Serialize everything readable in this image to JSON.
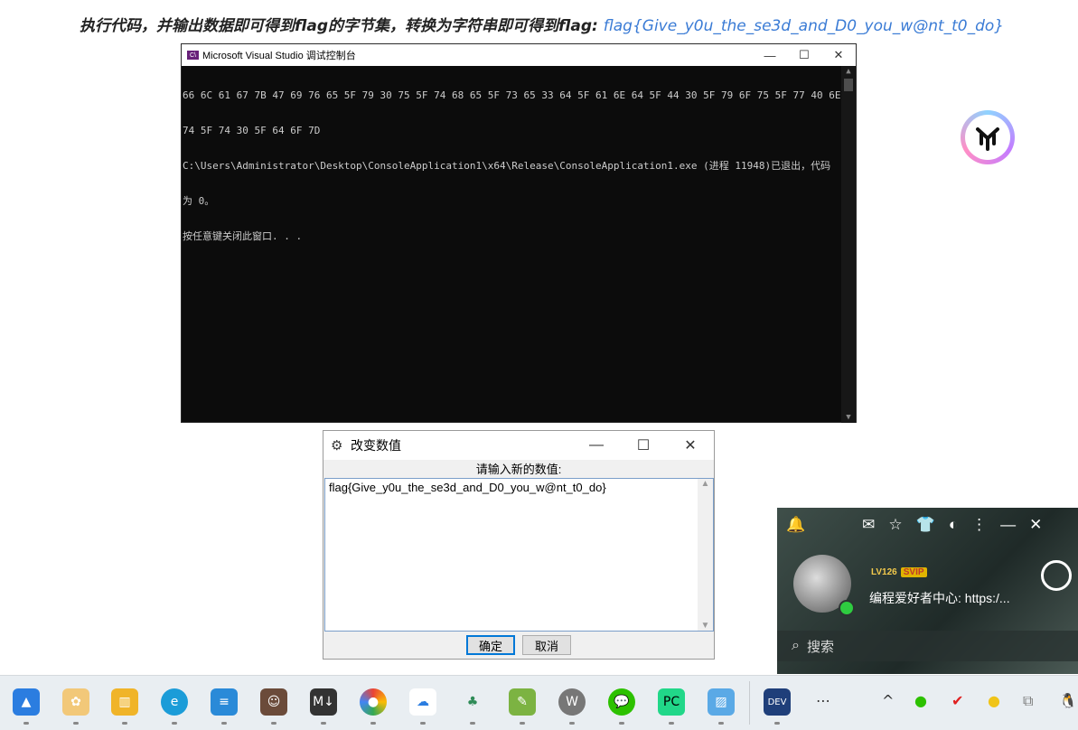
{
  "headline": {
    "text": "执行代码，并输出数据即可得到flag的字节集，转换为字符串即可得到flag:",
    "flag": "flag{Give_y0u_the_se3d_and_D0_you_w@nt_t0_do}"
  },
  "console": {
    "title": "Microsoft Visual Studio 调试控制台",
    "minimize": "—",
    "maximize": "☐",
    "close": "✕",
    "lines": [
      "66 6C 61 67 7B 47 69 76 65 5F 79 30 75 5F 74 68 65 5F 73 65 33 64 5F 61 6E 64 5F 44 30 5F 79 6F 75 5F 77 40 6E",
      "74 5F 74 30 5F 64 6F 7D",
      "C:\\Users\\Administrator\\Desktop\\ConsoleApplication1\\x64\\Release\\ConsoleApplication1.exe (进程 11948)已退出，代码",
      "为 0。",
      "按任意键关闭此窗口. . ."
    ]
  },
  "dialog": {
    "title": "改变数值",
    "prompt": "请输入新的数值:",
    "value": "flag{Give_y0u_the_se3d_and_D0_you_w@nt_t0_do}",
    "ok": "确定",
    "cancel": "取消",
    "minimize": "—",
    "maximize": "☐",
    "close": "✕"
  },
  "qq": {
    "level": "LV126",
    "vip": "SVIP",
    "signature": "编程爱好者中心: https:/...",
    "search_placeholder": "搜索"
  },
  "taskbar": {
    "more": "⋯",
    "tray_chevron": "^"
  }
}
